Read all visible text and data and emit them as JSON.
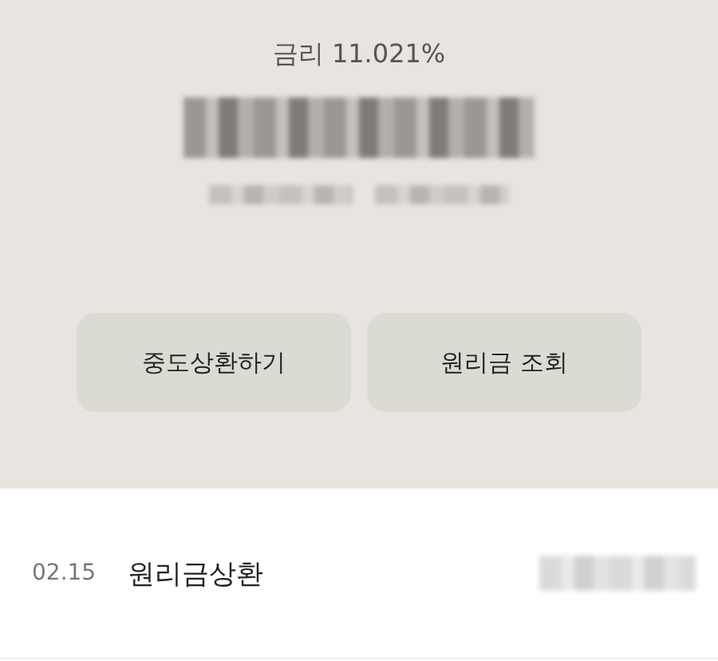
{
  "summary": {
    "rate_label": "금리 11.021%"
  },
  "buttons": [
    {
      "label": "중도상환하기"
    },
    {
      "label": "원리금 조회"
    }
  ],
  "transactions": [
    {
      "date": "02.15",
      "title": "원리금상환"
    }
  ]
}
